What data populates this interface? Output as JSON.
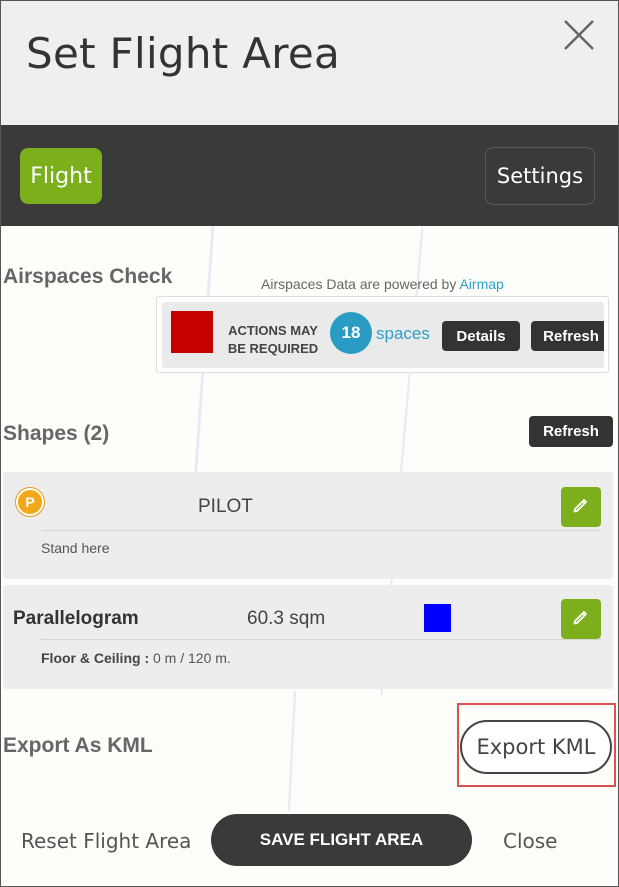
{
  "dialog": {
    "title": "Set Flight Area",
    "close_icon": "close-icon"
  },
  "tabs": [
    {
      "label": "Flight",
      "active": true
    },
    {
      "label": "Settings",
      "active": false
    }
  ],
  "airspaces": {
    "heading": "Airspaces Check",
    "powered_prefix": "Airspaces Data are powered by ",
    "powered_link": "Airmap",
    "status_color": "#c40000",
    "status_line1": "ACTIONS MAY",
    "status_line2": "BE REQUIRED",
    "count": "18",
    "count_label": "spaces",
    "details_label": "Details",
    "refresh_label": "Refresh"
  },
  "shapes": {
    "heading": "Shapes (2)",
    "refresh_label": "Refresh",
    "items": [
      {
        "icon": "pilot-marker-icon",
        "icon_letter": "P",
        "name": "PILOT",
        "note": "Stand here",
        "edit_icon": "pencil-icon"
      },
      {
        "name": "Parallelogram",
        "area": "60.3 sqm",
        "color": "#0000ff",
        "floor_ceiling_label": "Floor & Ceiling :",
        "floor_ceiling_value": " 0 m / 120 m.",
        "edit_icon": "pencil-icon"
      }
    ]
  },
  "export": {
    "heading": "Export As KML",
    "button_label": "Export KML"
  },
  "footer": {
    "reset_label": "Reset Flight Area",
    "save_label": "SAVE FLIGHT AREA",
    "close_label": "Close"
  },
  "colors": {
    "accent_green": "#7caf1c",
    "dark_bar": "#3a3a3a",
    "link_blue": "#2aa0c8"
  }
}
